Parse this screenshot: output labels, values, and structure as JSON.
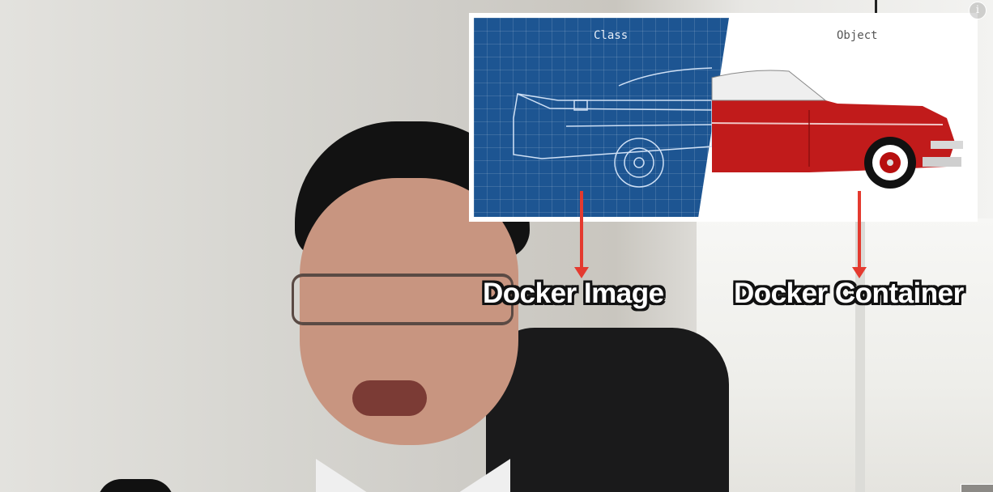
{
  "diagram": {
    "left_caption": "Class",
    "right_caption": "Object"
  },
  "labels": {
    "left": "Docker Image",
    "right": "Docker Container"
  },
  "icons": {
    "info": "info-icon"
  },
  "info_glyph": "i",
  "colors": {
    "arrow": "#e43a2f",
    "blueprint": "#1d5592",
    "car_body": "#c11b1b"
  }
}
